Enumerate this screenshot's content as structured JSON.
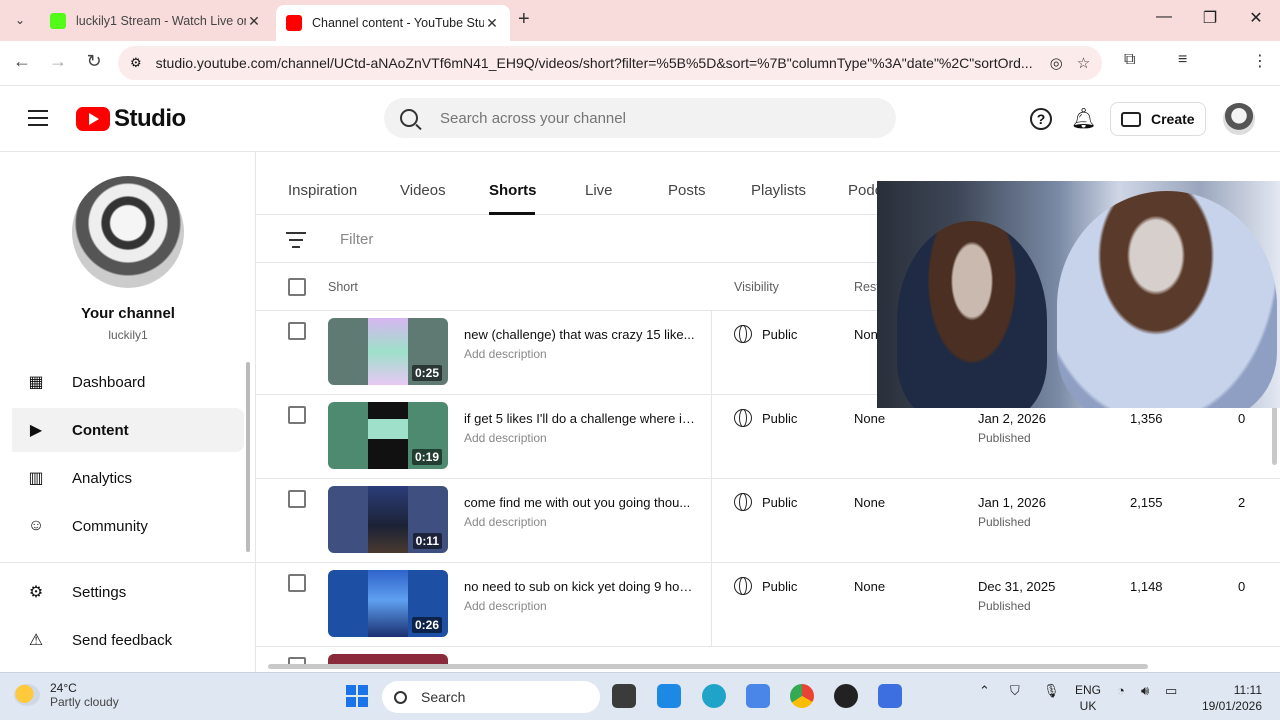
{
  "browser": {
    "tabs": [
      {
        "title": "luckily1 Stream - Watch Live on",
        "favicon_color": "#53fc18"
      },
      {
        "title": "Channel content - YouTube Stu",
        "favicon_color": "#ff0000"
      }
    ],
    "url": "studio.youtube.com/channel/UCtd-aNAoZnVTf6mN41_EH9Q/videos/short?filter=%5B%5D&sort=%7B\"columnType\"%3A\"date\"%2C\"sortOrd..."
  },
  "header": {
    "logo_text": "Studio",
    "search_placeholder": "Search across your channel",
    "create_label": "Create"
  },
  "sidebar": {
    "channel_title": "Your channel",
    "channel_handle": "luckily1",
    "items": [
      {
        "label": "Dashboard",
        "icon": "dashboard-icon"
      },
      {
        "label": "Content",
        "icon": "content-icon",
        "active": true
      },
      {
        "label": "Analytics",
        "icon": "analytics-icon"
      },
      {
        "label": "Community",
        "icon": "community-icon"
      },
      {
        "label": "Settings",
        "icon": "gear-icon"
      },
      {
        "label": "Send feedback",
        "icon": "feedback-icon"
      }
    ]
  },
  "content_tabs": [
    "Inspiration",
    "Videos",
    "Shorts",
    "Live",
    "Posts",
    "Playlists",
    "Podc"
  ],
  "active_tab": "Shorts",
  "filter_label": "Filter",
  "columns": {
    "short": "Short",
    "visibility": "Visibility",
    "restrictions": "Rest"
  },
  "rows": [
    {
      "title": "new (challenge) that was crazy 15 like...",
      "desc": "Add description",
      "duration": "0:25",
      "visibility": "Public",
      "restrictions": "None",
      "date": "",
      "status": "",
      "views": "",
      "comments": "",
      "thumb_bg": "#5e7a73",
      "thumb_inner": "#9ee0c9"
    },
    {
      "title": "if get 5 likes I'll do a challenge where if...",
      "desc": "Add description",
      "duration": "0:19",
      "visibility": "Public",
      "restrictions": "None",
      "date": "Jan 2, 2026",
      "status": "Published",
      "views": "1,356",
      "comments": "0",
      "thumb_bg": "#4d8a70",
      "thumb_inner": "#111111"
    },
    {
      "title": "come find me with out you going thou...",
      "desc": "Add description",
      "duration": "0:11",
      "visibility": "Public",
      "restrictions": "None",
      "date": "Jan 1, 2026",
      "status": "Published",
      "views": "2,155",
      "comments": "2",
      "thumb_bg": "#3f4f80",
      "thumb_inner": "#1c2235"
    },
    {
      "title": "no need to sub on kick yet doing 9 hou...",
      "desc": "Add description",
      "duration": "0:26",
      "visibility": "Public",
      "restrictions": "None",
      "date": "Dec 31, 2025",
      "status": "Published",
      "views": "1,148",
      "comments": "0",
      "thumb_bg": "#1d4fa5",
      "thumb_inner": "#2f63c9"
    }
  ],
  "taskbar": {
    "temperature": "24°C",
    "weather": "Partly cloudy",
    "search_label": "Search",
    "lang_line1": "ENG",
    "lang_line2": "UK",
    "time": "11:11",
    "date": "19/01/2026"
  }
}
